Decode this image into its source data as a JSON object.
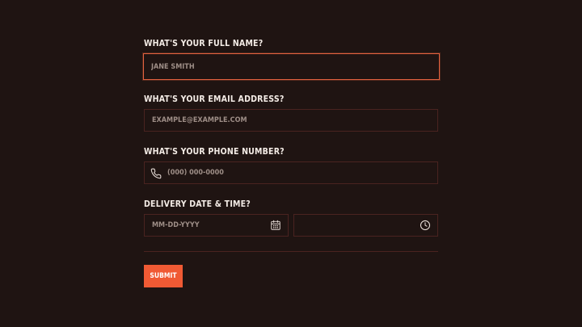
{
  "form": {
    "name_label": "WHAT'S YOUR FULL NAME?",
    "name_placeholder": "JANE SMITH",
    "email_label": "WHAT'S YOUR EMAIL ADDRESS?",
    "email_placeholder": "EXAMPLE@EXAMPLE.COM",
    "phone_label": "WHAT'S YOUR PHONE NUMBER?",
    "phone_placeholder": "(000) 000-0000",
    "delivery_label": "DELIVERY DATE & TIME?",
    "date_placeholder": "MM-DD-YYYY",
    "time_placeholder": "",
    "submit_label": "SUBMIT"
  },
  "icons": {
    "phone": "phone-icon",
    "calendar": "calendar-icon",
    "clock": "clock-icon"
  },
  "colors": {
    "background": "#1f1412",
    "border": "#4a2320",
    "focus_border": "#e2623f",
    "accent": "#f05a34",
    "label": "#f4ece6"
  }
}
